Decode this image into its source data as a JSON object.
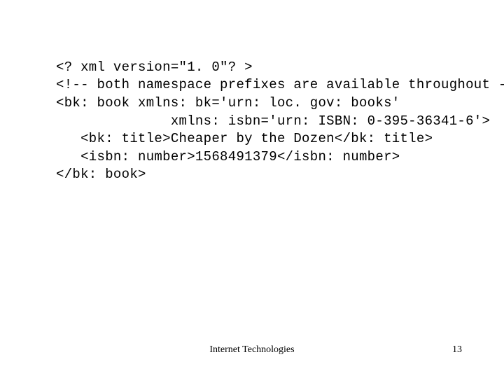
{
  "code": {
    "l1": "<? xml version=\"1. 0\"? >",
    "l2": "<!-- both namespace prefixes are available throughout -->",
    "l3": "<bk: book xmlns: bk='urn: loc. gov: books'",
    "l4": "              xmlns: isbn='urn: ISBN: 0-395-36341-6'>",
    "l5": "   <bk: title>Cheaper by the Dozen</bk: title>",
    "l6": "   <isbn: number>1568491379</isbn: number>",
    "l7": "</bk: book>"
  },
  "footer": {
    "title": "Internet Technologies",
    "page": "13"
  }
}
